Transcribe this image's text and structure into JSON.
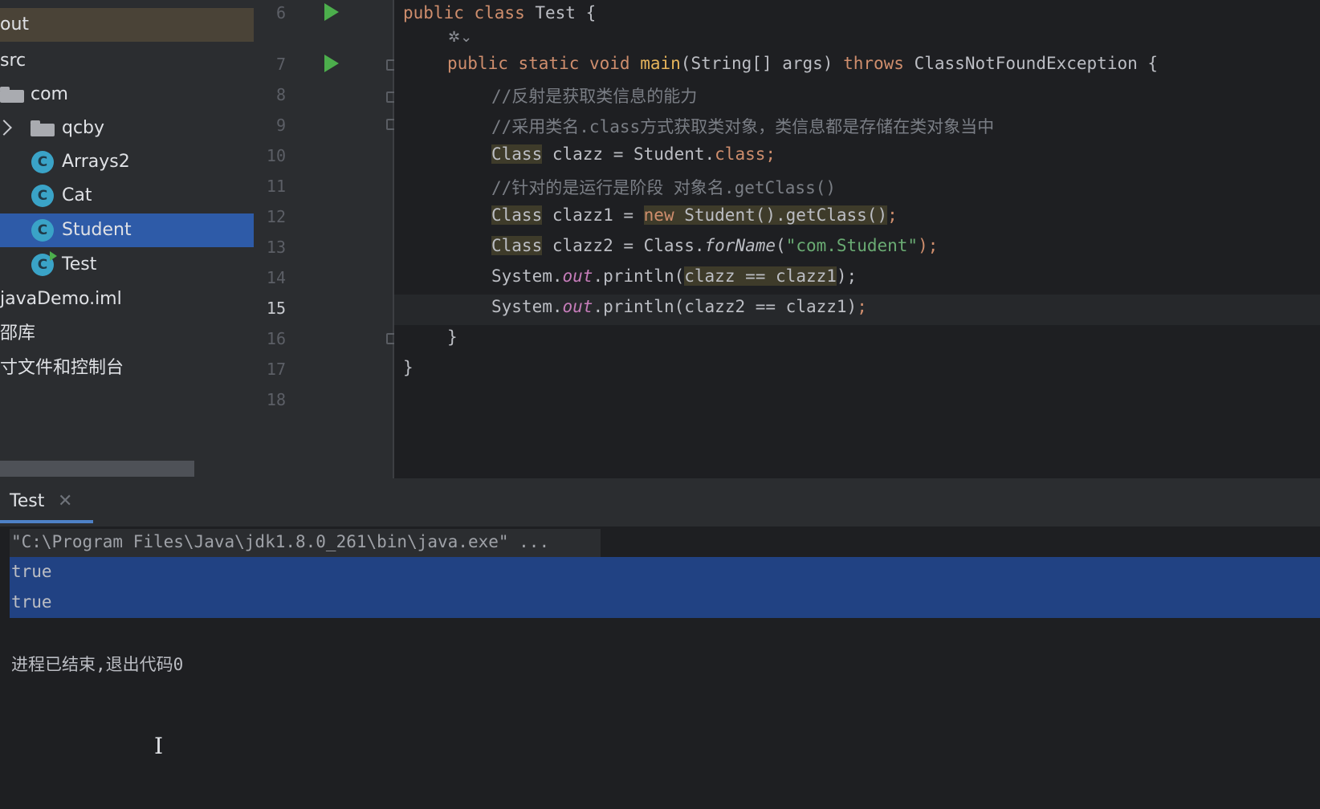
{
  "sidebar": {
    "items": [
      {
        "label": "out"
      },
      {
        "label": "src"
      },
      {
        "label": "com"
      },
      {
        "label": "qcby"
      },
      {
        "label": "Arrays2"
      },
      {
        "label": "Cat"
      },
      {
        "label": "Student"
      },
      {
        "label": "Test"
      },
      {
        "label": "javaDemo.iml"
      },
      {
        "label": "邵库"
      },
      {
        "label": "寸文件和控制台"
      }
    ],
    "class_icon_letter": "C",
    "selected": "Student"
  },
  "editor": {
    "line_numbers": [
      "6",
      "7",
      "8",
      "9",
      "10",
      "11",
      "12",
      "13",
      "14",
      "15",
      "16",
      "17",
      "18"
    ],
    "active_line": "15",
    "code": {
      "l6": {
        "kw": "public class ",
        "name": "Test",
        "rest": " {"
      },
      "l7": {
        "kw": "public static void ",
        "method": "main",
        "params": "(String[] args) ",
        "throws": "throws ",
        "exc": "ClassNotFoundException {"
      },
      "l8": "//反射是获取类信息的能力",
      "l9": "//采用类名.class方式获取类对象，类信息都是存储在类对象当中",
      "l10": {
        "type": "Class",
        "a": " clazz = Student.",
        "kw": "class",
        "end": ";"
      },
      "l11": "//针对的是运行是阶段 对象名.getClass()",
      "l12": {
        "type": "Class",
        "a": " clazz1 = ",
        "kw": "new",
        "b": " Student().getClass()",
        "end": ";"
      },
      "l13": {
        "type": "Class",
        "a": " clazz2 = Class.",
        "method": "forName",
        "b": "(",
        "str": "\"com.Student\"",
        "end": ");"
      },
      "l14": {
        "a": "System.",
        "field": "out",
        "b": ".println(",
        "sel": "clazz == clazz1",
        "end": ");"
      },
      "l15": {
        "a": "System.",
        "field": "out",
        "b": ".println(clazz2 == clazz1)",
        "end": ";"
      },
      "l16": "}",
      "l17": "}"
    }
  },
  "run": {
    "tab_label": "Test",
    "close_glyph": "✕",
    "command": "\"C:\\Program Files\\Java\\jdk1.8.0_261\\bin\\java.exe\" ...",
    "output": [
      "true",
      "true"
    ],
    "exit_message": "进程已结束,退出代码0"
  },
  "colors": {
    "keyword": "#cf8e6d",
    "method": "#e6b45b",
    "comment": "#7a7e85",
    "string": "#6aab73",
    "selection": "#214283",
    "sidebar_selected": "#2e5ba8"
  }
}
